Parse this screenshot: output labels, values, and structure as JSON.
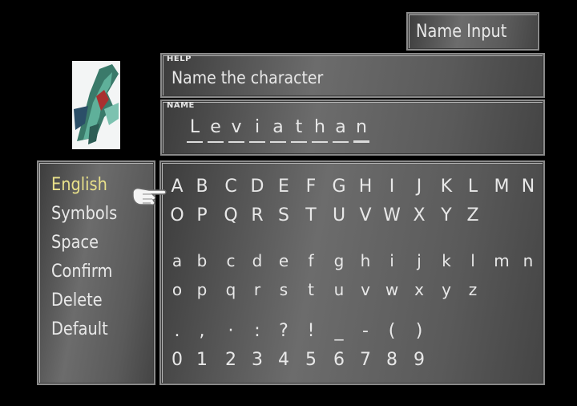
{
  "title": "Name Input",
  "help": {
    "tag": "HELP",
    "text": "Name the character"
  },
  "name": {
    "tag": "NAME",
    "letters": [
      "L",
      "e",
      "v",
      "i",
      "a",
      "t",
      "h",
      "a",
      "n"
    ]
  },
  "menu": [
    "English",
    "Symbols",
    "Space",
    "Confirm",
    "Delete",
    "Default"
  ],
  "selected_menu": "English",
  "grid_rows": [
    [
      "A",
      "B",
      "C",
      "D",
      "E",
      "F",
      "G",
      "H",
      "I",
      "J",
      "K",
      "L",
      "M",
      "N"
    ],
    [
      "O",
      "P",
      "Q",
      "R",
      "S",
      "T",
      "U",
      "V",
      "W",
      "X",
      "Y",
      "Z"
    ],
    [
      "a",
      "b",
      "c",
      "d",
      "e",
      "f",
      "g",
      "h",
      "i",
      "j",
      "k",
      "l",
      "m",
      "n"
    ],
    [
      "o",
      "p",
      "q",
      "r",
      "s",
      "t",
      "u",
      "v",
      "w",
      "x",
      "y",
      "z"
    ],
    [
      ".",
      ",",
      "·",
      ":",
      "?",
      "!",
      "_",
      "-",
      "(",
      ")"
    ],
    [
      "0",
      "1",
      "2",
      "3",
      "4",
      "5",
      "6",
      "7",
      "8",
      "9"
    ]
  ],
  "selected_char": "A",
  "icons": {
    "pointer": "hand-pointer-icon",
    "portrait": "leviathan-portrait"
  },
  "colors": {
    "highlight": "#e8e08a",
    "text": "#e8e8e8"
  }
}
